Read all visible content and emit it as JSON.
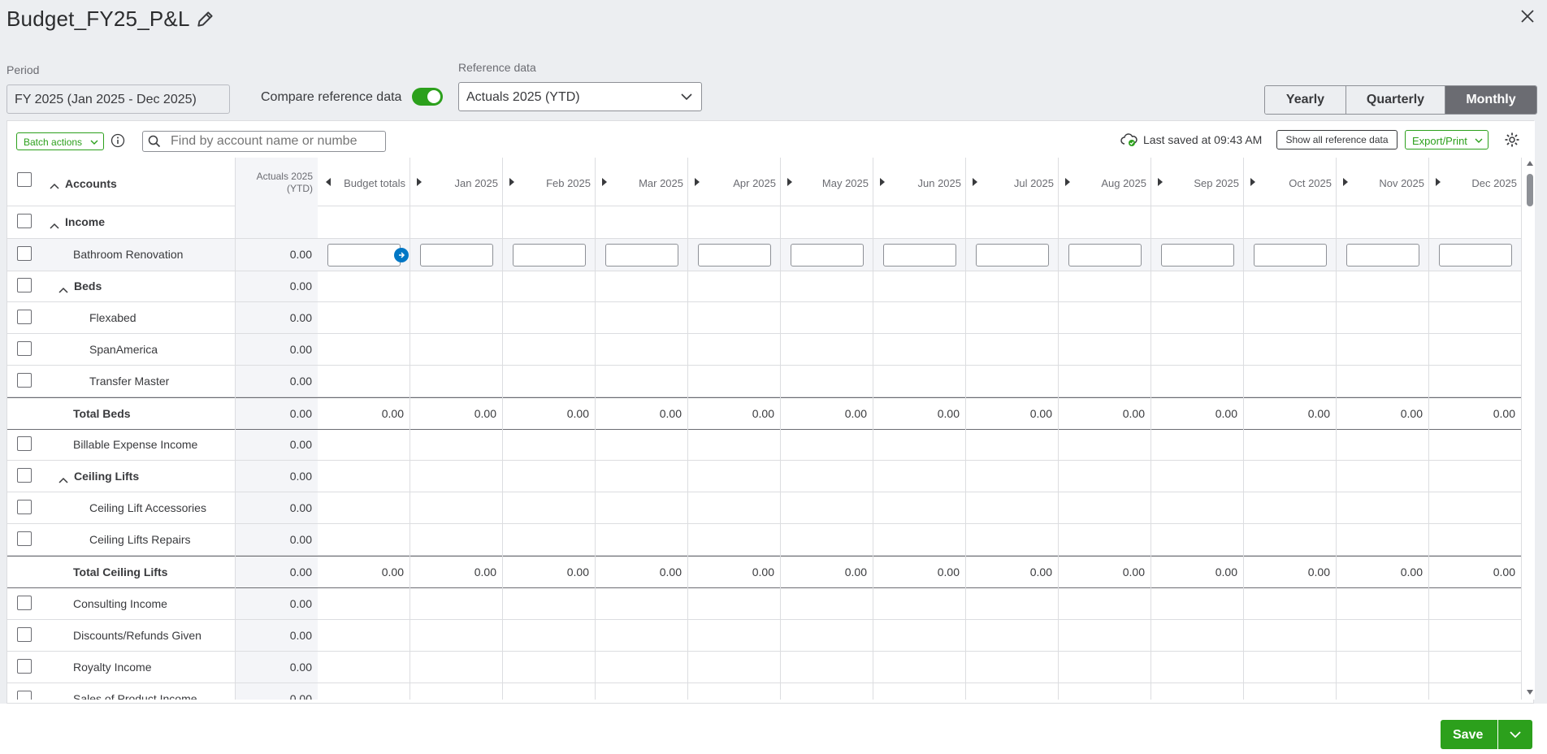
{
  "header": {
    "title": "Budget_FY25_P&L",
    "period_label": "Period",
    "period_value": "FY 2025 (Jan 2025 - Dec 2025)",
    "compare_label": "Compare reference data",
    "compare_enabled": true,
    "reference_label": "Reference data",
    "reference_value": "Actuals 2025 (YTD)",
    "view_options": [
      "Yearly",
      "Quarterly",
      "Monthly"
    ],
    "selected_view": "Monthly"
  },
  "toolbar": {
    "batch_label": "Batch actions",
    "search_placeholder": "Find by account name or number",
    "saved_text": "Last saved at 09:43 AM",
    "show_all_label": "Show all reference data",
    "export_label": "Export/Print"
  },
  "table": {
    "accounts_header": "Accounts",
    "actuals_header_line1": "Actuals 2025",
    "actuals_header_line2": "(YTD)",
    "budget_totals_header": "Budget totals",
    "months": [
      "Jan 2025",
      "Feb 2025",
      "Mar 2025",
      "Apr 2025",
      "May 2025",
      "Jun 2025",
      "Jul 2025",
      "Aug 2025",
      "Sep 2025",
      "Oct 2025",
      "Nov 2025",
      "Dec 2025"
    ],
    "rows": [
      {
        "label": "Income",
        "type": "group",
        "level": 0,
        "actual": ""
      },
      {
        "label": "Bathroom Renovation",
        "type": "edit",
        "level": 1,
        "actual": "0.00"
      },
      {
        "label": "Beds",
        "type": "subgroup",
        "level": 1,
        "actual": "0.00"
      },
      {
        "label": "Flexabed",
        "type": "item",
        "level": 2,
        "actual": "0.00"
      },
      {
        "label": "SpanAmerica",
        "type": "item",
        "level": 2,
        "actual": "0.00"
      },
      {
        "label": "Transfer Master",
        "type": "item",
        "level": 2,
        "actual": "0.00"
      },
      {
        "label": "Total Beds",
        "type": "total",
        "level": 1,
        "actual": "0.00",
        "budget_total": "0.00",
        "monthly": [
          "0.00",
          "0.00",
          "0.00",
          "0.00",
          "0.00",
          "0.00",
          "0.00",
          "0.00",
          "0.00",
          "0.00",
          "0.00",
          "0.00"
        ]
      },
      {
        "label": "Billable Expense Income",
        "type": "item",
        "level": 1,
        "actual": "0.00"
      },
      {
        "label": "Ceiling Lifts",
        "type": "subgroup",
        "level": 1,
        "actual": "0.00"
      },
      {
        "label": "Ceiling Lift Accessories",
        "type": "item",
        "level": 2,
        "actual": "0.00"
      },
      {
        "label": "Ceiling Lifts Repairs",
        "type": "item",
        "level": 2,
        "actual": "0.00"
      },
      {
        "label": "Total Ceiling Lifts",
        "type": "total",
        "level": 1,
        "actual": "0.00",
        "budget_total": "0.00",
        "monthly": [
          "0.00",
          "0.00",
          "0.00",
          "0.00",
          "0.00",
          "0.00",
          "0.00",
          "0.00",
          "0.00",
          "0.00",
          "0.00",
          "0.00"
        ]
      },
      {
        "label": "Consulting Income",
        "type": "item",
        "level": 1,
        "actual": "0.00"
      },
      {
        "label": "Discounts/Refunds Given",
        "type": "item",
        "level": 1,
        "actual": "0.00"
      },
      {
        "label": "Royalty Income",
        "type": "item",
        "level": 1,
        "actual": "0.00"
      },
      {
        "label": "Sales of Product Income",
        "type": "item",
        "level": 1,
        "actual": "0.00"
      }
    ]
  },
  "footer": {
    "save_label": "Save"
  },
  "colors": {
    "accent_green": "#2ca01c",
    "selected_segment": "#6b6c72",
    "info_blue": "#0077c5"
  }
}
